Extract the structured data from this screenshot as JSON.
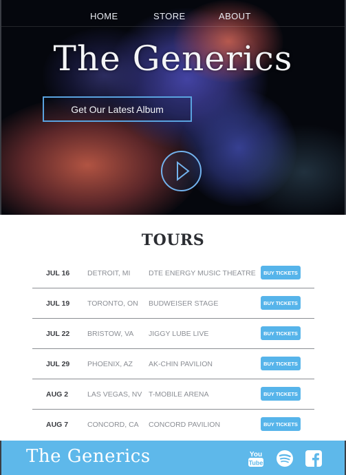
{
  "nav": {
    "home": "HOME",
    "store": "STORE",
    "about": "ABOUT"
  },
  "hero": {
    "band_name": "The Generics",
    "album_button": "Get Our Latest Album"
  },
  "tours": {
    "title": "TOURS",
    "rows": [
      {
        "date": "JUL 16",
        "city": "DETROIT, MI",
        "venue": "DTE ENERGY MUSIC THEATRE",
        "button": "BUY TICKETS"
      },
      {
        "date": "JUL 19",
        "city": "TORONTO, ON",
        "venue": "BUDWEISER STAGE",
        "button": "BUY TICKETS"
      },
      {
        "date": "JUL 22",
        "city": "BRISTOW, VA",
        "venue": "JIGGY LUBE LIVE",
        "button": "BUY TICKETS"
      },
      {
        "date": "JUL 29",
        "city": "PHOENIX, AZ",
        "venue": "AK-CHIN PAVILION",
        "button": "BUY TICKETS"
      },
      {
        "date": "AUG 2",
        "city": "LAS VEGAS, NV",
        "venue": "T-MOBILE ARENA",
        "button": "BUY TICKETS"
      },
      {
        "date": "AUG 7",
        "city": "CONCORD, CA",
        "venue": "CONCORD PAVILION",
        "button": "BUY TICKETS"
      }
    ]
  },
  "footer": {
    "band_name": "The Generics",
    "youtube_text": "You Tube",
    "icons": [
      "youtube-icon",
      "spotify-icon",
      "facebook-icon"
    ]
  },
  "colors": {
    "accent": "#56b4ea",
    "footer_bg": "#5eb8ea",
    "hero_bg": "#05070d"
  }
}
